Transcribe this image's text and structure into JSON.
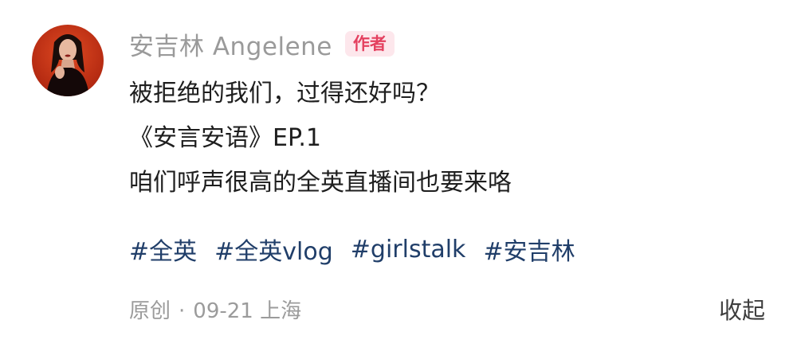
{
  "author": {
    "name": "安吉林 Angelene",
    "badge": "作者"
  },
  "post": {
    "lines": [
      "被拒绝的我们，过得还好吗？",
      "《安言安语》EP.1",
      "咱们呼声很高的全英直播间也要来咯"
    ],
    "tags": [
      "#全英",
      "#全英vlog",
      "#girlstalk",
      "#安吉林"
    ]
  },
  "meta": {
    "type": "原创",
    "separator": "·",
    "date": "09-21",
    "location": "上海"
  },
  "actions": {
    "collapse_label": "收起"
  },
  "colors": {
    "tag": "#203e69",
    "badge_text": "#e4405f",
    "badge_bg": "#fde7ec",
    "muted": "#9a9a9a"
  }
}
